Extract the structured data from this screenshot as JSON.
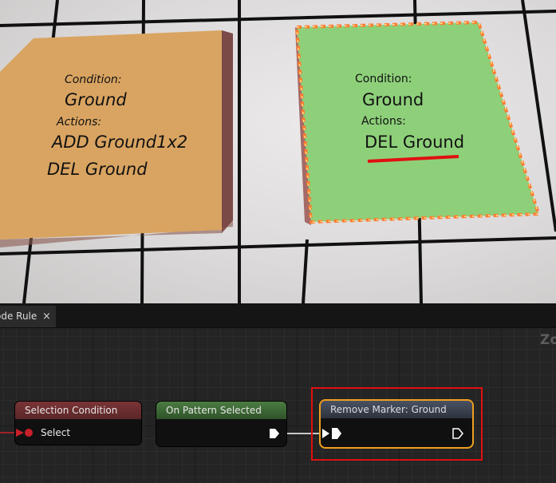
{
  "viewport": {
    "left_tile": {
      "condition_label": "Condition:",
      "condition_value": "Ground",
      "actions_label": "Actions:",
      "action_1": "ADD Ground1x2",
      "action_2": "DEL Ground",
      "color": "#d9a461"
    },
    "right_tile": {
      "condition_label": "Condition:",
      "condition_value": "Ground",
      "actions_label": "Actions:",
      "action_1": "DEL Ground",
      "color": "#8ed07a",
      "underline_color": "#e01010"
    }
  },
  "editor": {
    "tab_label": "ode Rule",
    "tab_close": "×",
    "zoom_label": "Zo",
    "nodes": {
      "selection_condition": {
        "title": "Selection Condition",
        "pin": "Select",
        "header_color": "#6e2f31"
      },
      "on_pattern_selected": {
        "title": "On Pattern Selected",
        "header_color": "#3f6a38"
      },
      "remove_marker": {
        "title": "Remove Marker: Ground",
        "header_color": "#3d4452",
        "border_color": "#f0a020"
      }
    },
    "highlight_color": "#e01010"
  }
}
